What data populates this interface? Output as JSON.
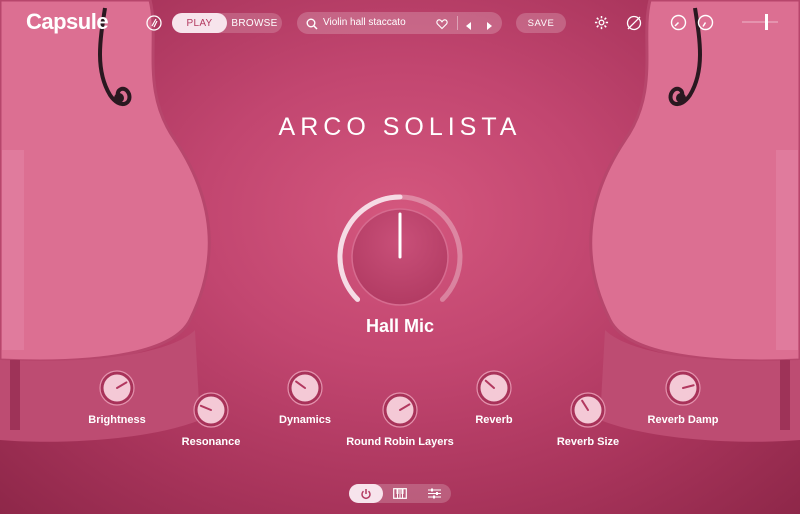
{
  "app": {
    "logo": "Capsule"
  },
  "header": {
    "tabs": [
      {
        "label": "PLAY",
        "active": true
      },
      {
        "label": "BROWSE",
        "active": false
      }
    ],
    "preset_name": "Violin hall staccato",
    "save_label": "SAVE"
  },
  "instrument_title": "ARCO SOLISTA",
  "main_knob": {
    "label": "Hall Mic",
    "value": 0.5
  },
  "knobs": [
    {
      "label": "Brightness",
      "value": 0.72
    },
    {
      "label": "Resonance",
      "value": 0.25
    },
    {
      "label": "Dynamics",
      "value": 0.3
    },
    {
      "label": "Round Robin Layers",
      "value": 0.72
    },
    {
      "label": "Reverb",
      "value": 0.32
    },
    {
      "label": "Reverb Size",
      "value": 0.38
    },
    {
      "label": "Reverb Damp",
      "value": 0.78
    }
  ],
  "bottom_tabs": [
    {
      "icon": "power-icon",
      "active": true
    },
    {
      "icon": "piano-icon",
      "active": false
    },
    {
      "icon": "sliders-icon",
      "active": false
    }
  ],
  "colors": {
    "background": "#c24670",
    "accent_light": "#f7e4ec",
    "knob_body": "#f4c9d6"
  }
}
